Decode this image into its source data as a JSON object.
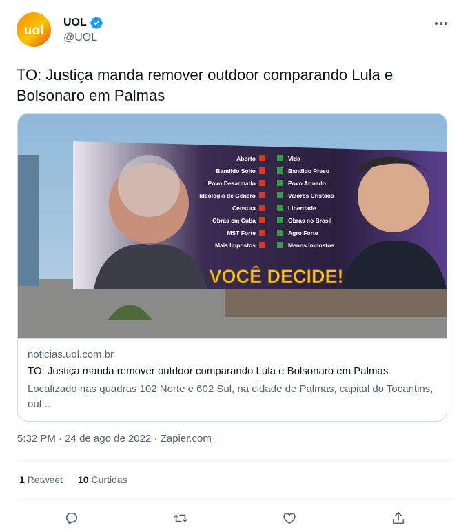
{
  "author": {
    "name": "UOL",
    "handle": "@UOL",
    "avatar_text": "uol"
  },
  "tweet": {
    "text": "TO: Justiça manda remover outdoor comparando Lula e Bolsonaro em Palmas"
  },
  "card": {
    "domain": "noticias.uol.com.br",
    "title": "TO: Justiça manda remover outdoor comparando Lula e Bolsonaro em Palmas",
    "description": "Localizado nas quadras 102 Norte e 602 Sul, na cidade de Palmas, capital do Tocantins, out...",
    "billboard": {
      "left_items": [
        "Aborto",
        "Bandido Solto",
        "Povo Desarmado",
        "Ideologia de Gênero",
        "Censura",
        "Obras em Cuba",
        "MST Forte",
        "Mais Impostos"
      ],
      "right_items": [
        "Vida",
        "Bandido Preso",
        "Povo Armado",
        "Valores Cristãos",
        "Liberdade",
        "Obras no Brasil",
        "Agro Forte",
        "Menos Impostos"
      ],
      "slogan": "VOCÊ DECIDE!"
    }
  },
  "meta": {
    "time": "5:32 PM",
    "sep1": "·",
    "date": "24 de ago de 2022",
    "sep2": "·",
    "source": "Zapier.com"
  },
  "stats": {
    "retweets_count": "1",
    "retweets_label": "Retweet",
    "likes_count": "10",
    "likes_label": "Curtidas"
  },
  "icons": {
    "more": "more-icon",
    "verified": "verified-badge-icon",
    "reply": "reply-icon",
    "retweet": "retweet-icon",
    "like": "heart-icon",
    "share": "share-icon"
  },
  "colors": {
    "verified": "#1d9bf0",
    "secondary_text": "#536471",
    "border": "#cfd9de",
    "billboard_bg": "#2a1f3d",
    "slogan": "#f2c230"
  }
}
